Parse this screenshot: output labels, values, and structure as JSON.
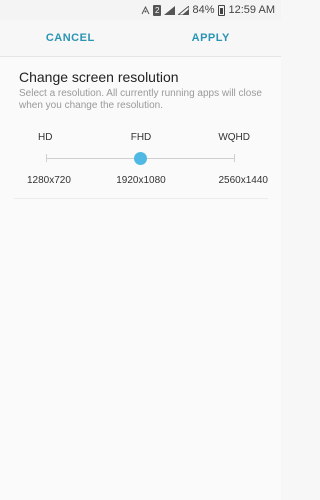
{
  "status_bar": {
    "sim_badge": "2",
    "battery": "84%",
    "time": "12:59 AM"
  },
  "action_bar": {
    "cancel_label": "CANCEL",
    "apply_label": "APPLY"
  },
  "resolution": {
    "title": "Change screen resolution",
    "description": "Select a resolution. All currently running apps will close when you change the resolution.",
    "options": [
      {
        "name": "HD",
        "value": "1280x720"
      },
      {
        "name": "FHD",
        "value": "1920x1080"
      },
      {
        "name": "WQHD",
        "value": "2560x1440"
      }
    ],
    "selected_index": 1
  },
  "colors": {
    "accent": "#2b94b4",
    "thumb": "#4fb9e3"
  }
}
